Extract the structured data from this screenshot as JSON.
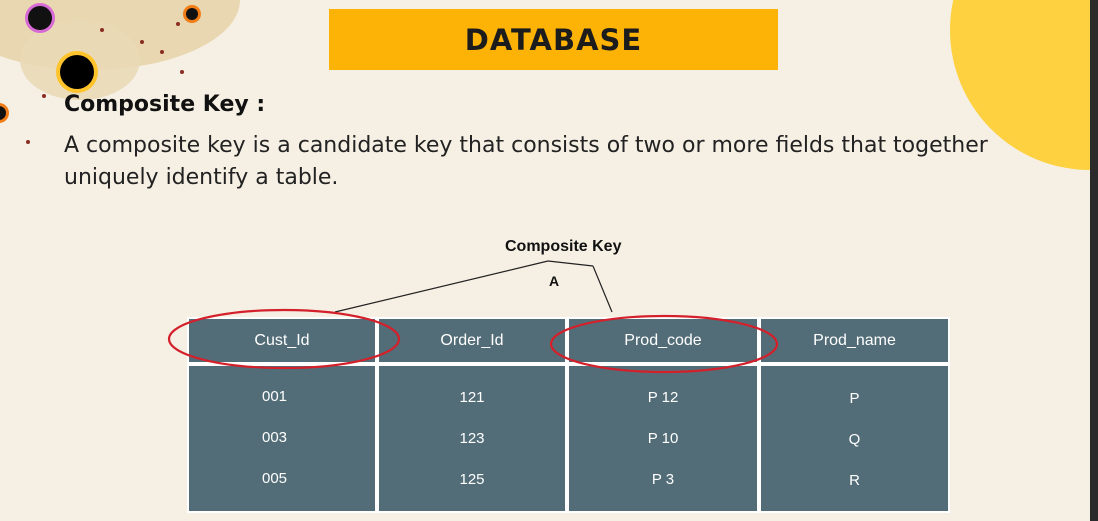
{
  "title": "DATABASE",
  "heading": "Composite Key :",
  "description": "A composite key is a candidate key that consists of two or more fields that together uniquely identify a table.",
  "diagram": {
    "label": "Composite Key",
    "apex_label": "A"
  },
  "table": {
    "columns": [
      "Cust_Id",
      "Order_Id",
      "Prod_code",
      "Prod_name"
    ],
    "rows": [
      [
        "001",
        "121",
        "P 12",
        "P"
      ],
      [
        "003",
        "123",
        "P 10",
        "Q"
      ],
      [
        "005",
        "125",
        "P 3",
        "R"
      ]
    ]
  },
  "colors": {
    "title_bg": "#fdb305",
    "table_bg": "#536d78",
    "highlight": "#d3202a",
    "accent_yellow": "#fdd13f"
  }
}
